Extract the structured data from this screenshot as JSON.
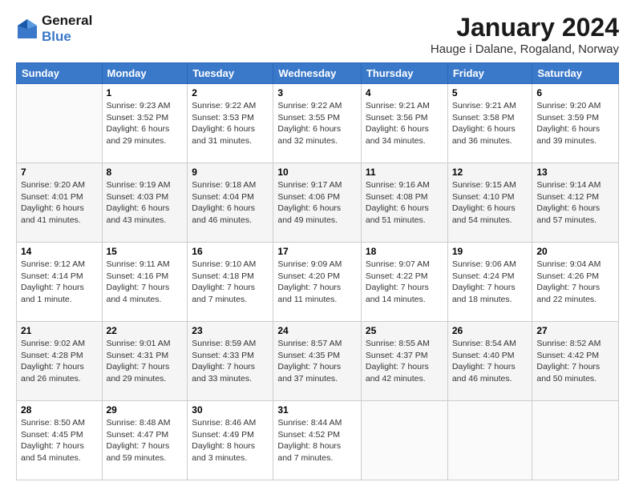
{
  "logo": {
    "line1": "General",
    "line2": "Blue"
  },
  "title": "January 2024",
  "location": "Hauge i Dalane, Rogaland, Norway",
  "days_of_week": [
    "Sunday",
    "Monday",
    "Tuesday",
    "Wednesday",
    "Thursday",
    "Friday",
    "Saturday"
  ],
  "weeks": [
    [
      {
        "day": "",
        "content": ""
      },
      {
        "day": "1",
        "content": "Sunrise: 9:23 AM\nSunset: 3:52 PM\nDaylight: 6 hours\nand 29 minutes."
      },
      {
        "day": "2",
        "content": "Sunrise: 9:22 AM\nSunset: 3:53 PM\nDaylight: 6 hours\nand 31 minutes."
      },
      {
        "day": "3",
        "content": "Sunrise: 9:22 AM\nSunset: 3:55 PM\nDaylight: 6 hours\nand 32 minutes."
      },
      {
        "day": "4",
        "content": "Sunrise: 9:21 AM\nSunset: 3:56 PM\nDaylight: 6 hours\nand 34 minutes."
      },
      {
        "day": "5",
        "content": "Sunrise: 9:21 AM\nSunset: 3:58 PM\nDaylight: 6 hours\nand 36 minutes."
      },
      {
        "day": "6",
        "content": "Sunrise: 9:20 AM\nSunset: 3:59 PM\nDaylight: 6 hours\nand 39 minutes."
      }
    ],
    [
      {
        "day": "7",
        "content": "Sunrise: 9:20 AM\nSunset: 4:01 PM\nDaylight: 6 hours\nand 41 minutes."
      },
      {
        "day": "8",
        "content": "Sunrise: 9:19 AM\nSunset: 4:03 PM\nDaylight: 6 hours\nand 43 minutes."
      },
      {
        "day": "9",
        "content": "Sunrise: 9:18 AM\nSunset: 4:04 PM\nDaylight: 6 hours\nand 46 minutes."
      },
      {
        "day": "10",
        "content": "Sunrise: 9:17 AM\nSunset: 4:06 PM\nDaylight: 6 hours\nand 49 minutes."
      },
      {
        "day": "11",
        "content": "Sunrise: 9:16 AM\nSunset: 4:08 PM\nDaylight: 6 hours\nand 51 minutes."
      },
      {
        "day": "12",
        "content": "Sunrise: 9:15 AM\nSunset: 4:10 PM\nDaylight: 6 hours\nand 54 minutes."
      },
      {
        "day": "13",
        "content": "Sunrise: 9:14 AM\nSunset: 4:12 PM\nDaylight: 6 hours\nand 57 minutes."
      }
    ],
    [
      {
        "day": "14",
        "content": "Sunrise: 9:12 AM\nSunset: 4:14 PM\nDaylight: 7 hours\nand 1 minute."
      },
      {
        "day": "15",
        "content": "Sunrise: 9:11 AM\nSunset: 4:16 PM\nDaylight: 7 hours\nand 4 minutes."
      },
      {
        "day": "16",
        "content": "Sunrise: 9:10 AM\nSunset: 4:18 PM\nDaylight: 7 hours\nand 7 minutes."
      },
      {
        "day": "17",
        "content": "Sunrise: 9:09 AM\nSunset: 4:20 PM\nDaylight: 7 hours\nand 11 minutes."
      },
      {
        "day": "18",
        "content": "Sunrise: 9:07 AM\nSunset: 4:22 PM\nDaylight: 7 hours\nand 14 minutes."
      },
      {
        "day": "19",
        "content": "Sunrise: 9:06 AM\nSunset: 4:24 PM\nDaylight: 7 hours\nand 18 minutes."
      },
      {
        "day": "20",
        "content": "Sunrise: 9:04 AM\nSunset: 4:26 PM\nDaylight: 7 hours\nand 22 minutes."
      }
    ],
    [
      {
        "day": "21",
        "content": "Sunrise: 9:02 AM\nSunset: 4:28 PM\nDaylight: 7 hours\nand 26 minutes."
      },
      {
        "day": "22",
        "content": "Sunrise: 9:01 AM\nSunset: 4:31 PM\nDaylight: 7 hours\nand 29 minutes."
      },
      {
        "day": "23",
        "content": "Sunrise: 8:59 AM\nSunset: 4:33 PM\nDaylight: 7 hours\nand 33 minutes."
      },
      {
        "day": "24",
        "content": "Sunrise: 8:57 AM\nSunset: 4:35 PM\nDaylight: 7 hours\nand 37 minutes."
      },
      {
        "day": "25",
        "content": "Sunrise: 8:55 AM\nSunset: 4:37 PM\nDaylight: 7 hours\nand 42 minutes."
      },
      {
        "day": "26",
        "content": "Sunrise: 8:54 AM\nSunset: 4:40 PM\nDaylight: 7 hours\nand 46 minutes."
      },
      {
        "day": "27",
        "content": "Sunrise: 8:52 AM\nSunset: 4:42 PM\nDaylight: 7 hours\nand 50 minutes."
      }
    ],
    [
      {
        "day": "28",
        "content": "Sunrise: 8:50 AM\nSunset: 4:45 PM\nDaylight: 7 hours\nand 54 minutes."
      },
      {
        "day": "29",
        "content": "Sunrise: 8:48 AM\nSunset: 4:47 PM\nDaylight: 7 hours\nand 59 minutes."
      },
      {
        "day": "30",
        "content": "Sunrise: 8:46 AM\nSunset: 4:49 PM\nDaylight: 8 hours\nand 3 minutes."
      },
      {
        "day": "31",
        "content": "Sunrise: 8:44 AM\nSunset: 4:52 PM\nDaylight: 8 hours\nand 7 minutes."
      },
      {
        "day": "",
        "content": ""
      },
      {
        "day": "",
        "content": ""
      },
      {
        "day": "",
        "content": ""
      }
    ]
  ]
}
